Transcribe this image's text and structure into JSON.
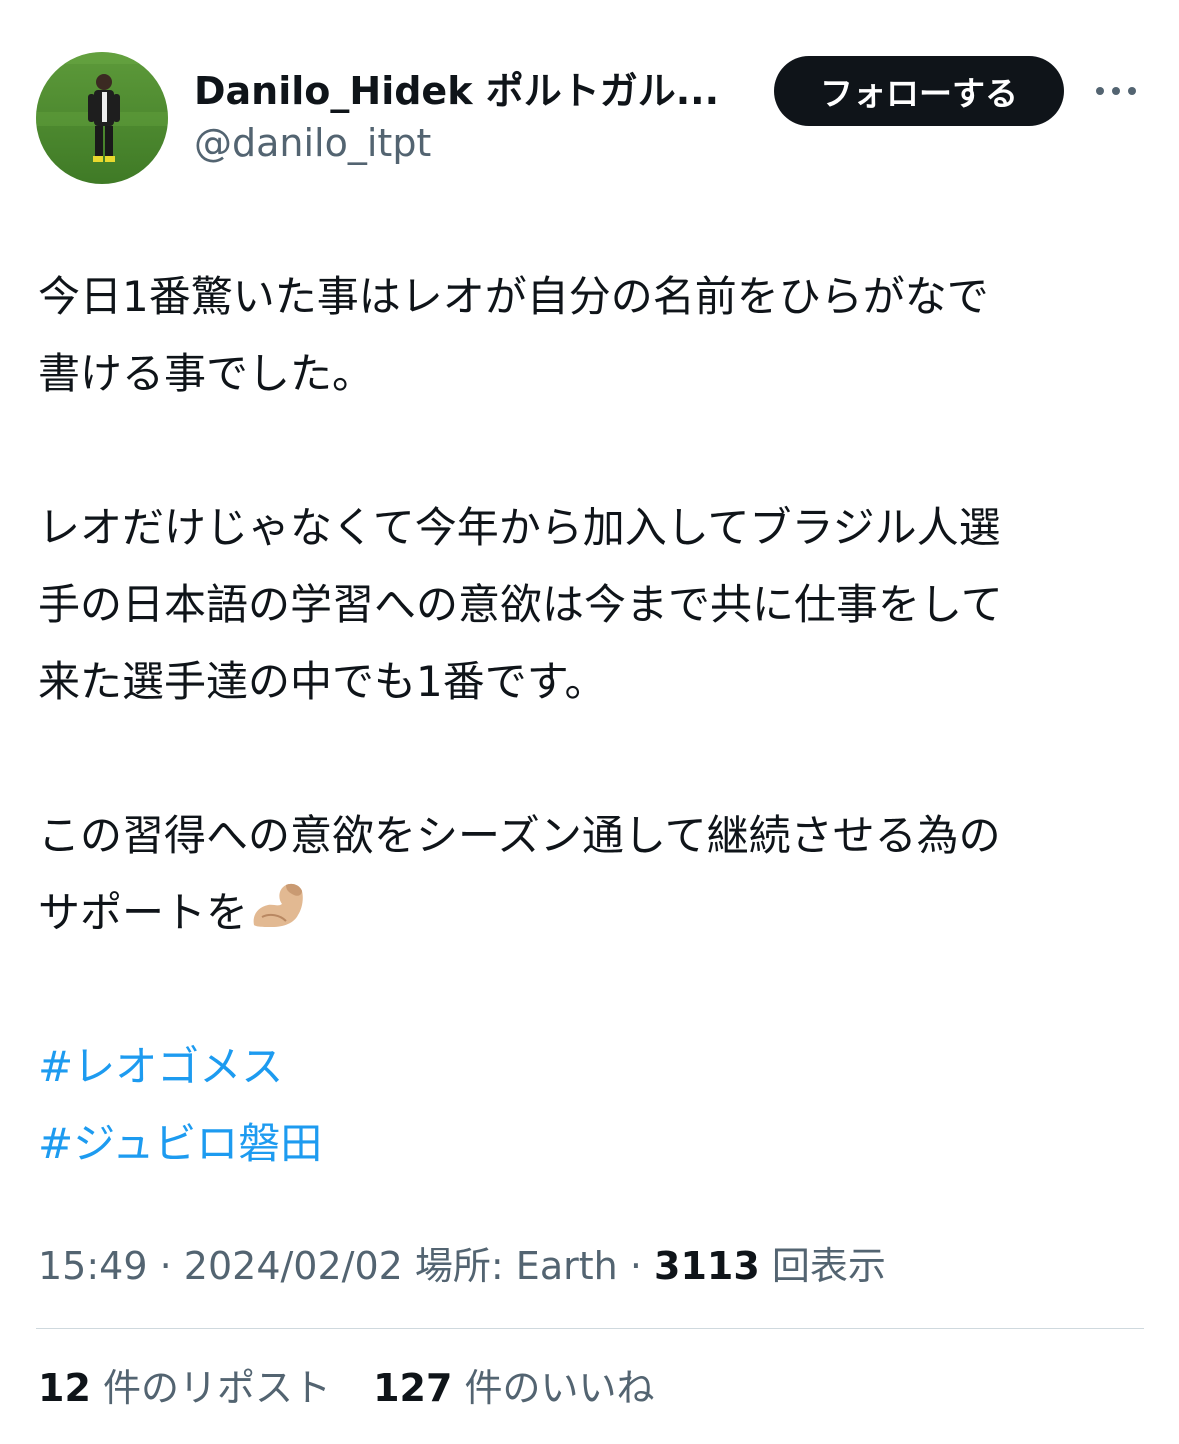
{
  "author": {
    "display_name": "Danilo_Hidek ポルトガル...",
    "handle": "@danilo_itpt"
  },
  "follow_button": {
    "label": "フォローする"
  },
  "more_menu": {
    "icon": "more-horizontal-icon"
  },
  "tweet": {
    "paragraphs": [
      [
        "今日1番驚いた事はレオが自分の名前をひらがなで",
        "書ける事でした。"
      ],
      [
        "レオだけじゃなくて今年から加入してブラジル人選",
        "手の日本語の学習への意欲は今まで共に仕事をして",
        "来た選手達の中でも1番です。"
      ],
      [
        "この習得への意欲をシーズン通して継続させる為の",
        "サポートを"
      ]
    ],
    "emoji": "flexed-biceps-icon",
    "hashtags": [
      "#レオゴメス",
      "#ジュビロ磐田"
    ]
  },
  "meta": {
    "time": "15:49",
    "separator": "·",
    "date": "2024/02/02",
    "location": "場所: Earth",
    "views_count": "3113",
    "views_label": "回表示"
  },
  "stats": {
    "reposts_count": "12",
    "reposts_label": "件のリポスト",
    "likes_count": "127",
    "likes_label": "件のいいね"
  },
  "colors": {
    "text": "#0f1419",
    "secondary": "#536471",
    "link": "#1d9bf0",
    "button_bg": "#0f1419",
    "divider": "#cfd9de"
  }
}
